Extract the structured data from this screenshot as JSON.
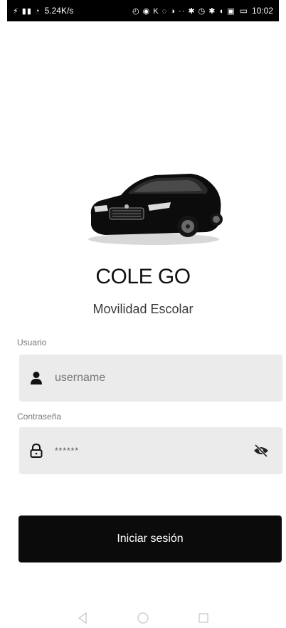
{
  "status_bar": {
    "left_icons": "⚡ ▮▮ ◔",
    "network_speed": "5.24K/s",
    "right_icons": "◴ ◉ K ◌ ◑ ·· ✱ ◷ ✱ ◖ ▣",
    "battery": "▭",
    "time": "10:02"
  },
  "brand": {
    "title": "COLE GO",
    "subtitle": "Movilidad Escolar"
  },
  "form": {
    "username_label": "Usuario",
    "username_placeholder": "username",
    "password_label": "Contraseña",
    "password_value": "******",
    "login_label": "Iniciar sesión"
  },
  "icons": {
    "username": "user-icon",
    "password": "lock-icon",
    "visibility": "eye-off-icon",
    "nav_back": "back-triangle-icon",
    "nav_home": "home-circle-icon",
    "nav_recents": "recents-square-icon"
  }
}
